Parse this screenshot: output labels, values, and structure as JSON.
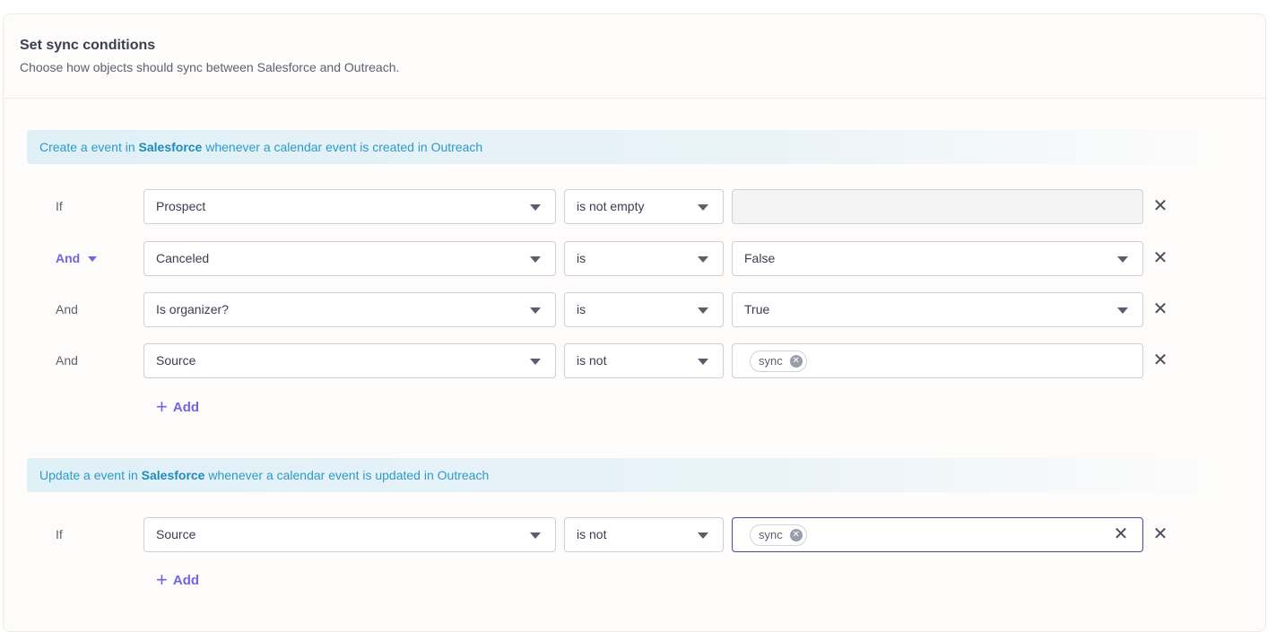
{
  "header": {
    "title": "Set sync conditions",
    "subtitle": "Choose how objects should sync between Salesforce and Outreach."
  },
  "sections": [
    {
      "banner": {
        "prefix": "Create a event in ",
        "app": "Salesforce",
        "suffix": " whenever a calendar event is created in Outreach"
      },
      "conditions": [
        {
          "conjunction": "If",
          "field": "Prospect",
          "operator": "is not empty",
          "value": "",
          "value_disabled": true
        },
        {
          "conjunction": "And",
          "field": "Canceled",
          "operator": "is",
          "value": "False"
        },
        {
          "conjunction": "And",
          "field": "Is organizer?",
          "operator": "is",
          "value": "True"
        },
        {
          "conjunction": "And",
          "field": "Source",
          "operator": "is not",
          "tags": [
            "sync"
          ]
        }
      ],
      "add_label": "Add"
    },
    {
      "banner": {
        "prefix": "Update a event in ",
        "app": "Salesforce",
        "suffix": " whenever a calendar event is updated in Outreach"
      },
      "conditions": [
        {
          "conjunction": "If",
          "field": "Source",
          "operator": "is not",
          "tags": [
            "sync"
          ]
        }
      ],
      "add_label": "Add"
    }
  ],
  "icons": {
    "remove": "close-icon",
    "dropdown": "caret-down-icon",
    "add": "plus-icon",
    "tag_remove": "circle-x-icon"
  },
  "colors": {
    "accent": "#7066e0",
    "banner_text": "#2d9bc7"
  }
}
